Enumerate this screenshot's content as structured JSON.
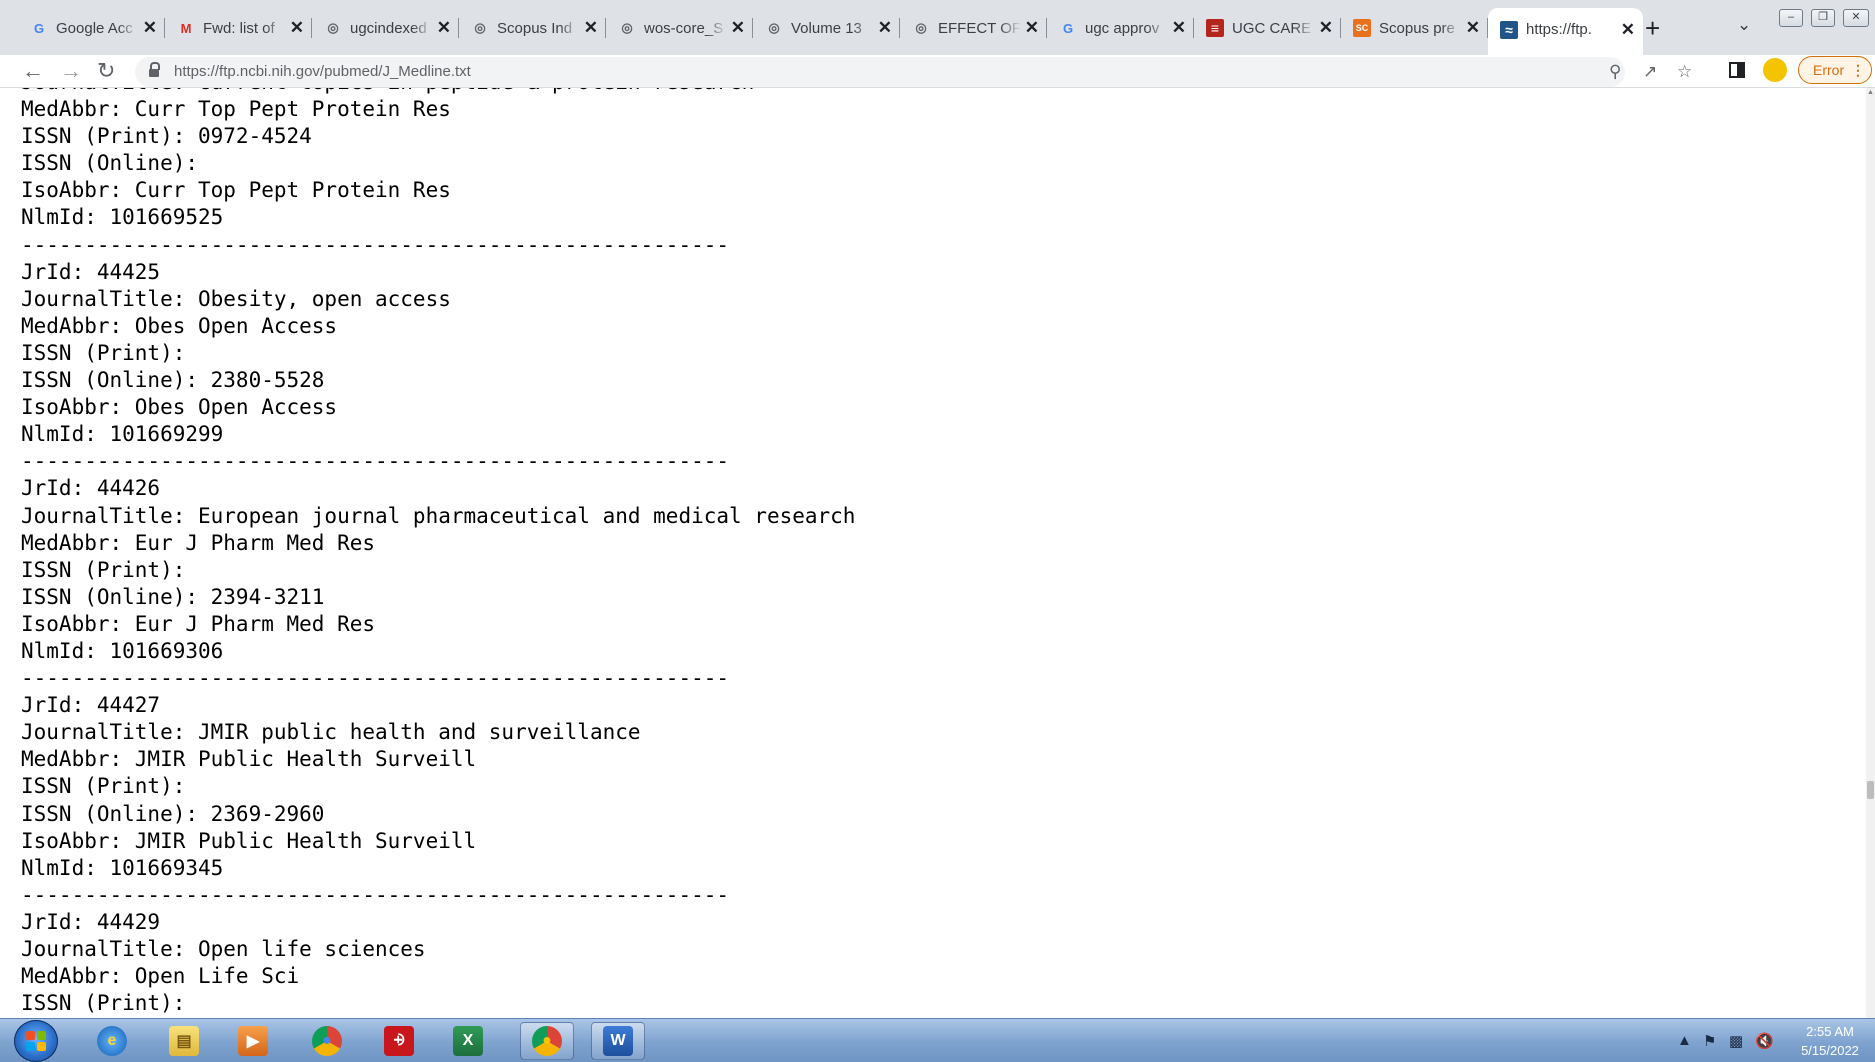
{
  "browser": {
    "tabs": [
      {
        "title": "Google Acc",
        "icon": "google-icon",
        "active": false
      },
      {
        "title": "Fwd: list of",
        "icon": "gmail-icon",
        "active": false
      },
      {
        "title": "ugcindexed",
        "icon": "globe-icon",
        "active": false
      },
      {
        "title": "Scopus Ind",
        "icon": "globe-icon",
        "active": false
      },
      {
        "title": "wos-core_S",
        "icon": "globe-icon",
        "active": false
      },
      {
        "title": "Volume 13",
        "icon": "globe-icon",
        "active": false
      },
      {
        "title": "EFFECT OF",
        "icon": "globe-icon",
        "active": false
      },
      {
        "title": "ugc approv",
        "icon": "google-icon",
        "active": false
      },
      {
        "title": "UGC CARE",
        "icon": "ugc-care-icon",
        "active": false
      },
      {
        "title": "Scopus pre",
        "icon": "scopus-icon",
        "active": false
      },
      {
        "title": "https://ftp.",
        "icon": "ncbi-icon",
        "active": true
      }
    ],
    "url": "https://ftp.ncbi.nih.gov/pubmed/J_Medline.txt",
    "error_label": "Error"
  },
  "document": {
    "lines": [
      "JournalTitle: Current topics in peptide & protein research",
      "MedAbbr: Curr Top Pept Protein Res",
      "ISSN (Print): 0972-4524",
      "ISSN (Online):",
      "IsoAbbr: Curr Top Pept Protein Res",
      "NlmId: 101669525",
      "--------------------------------------------------------",
      "JrId: 44425",
      "JournalTitle: Obesity, open access",
      "MedAbbr: Obes Open Access",
      "ISSN (Print):",
      "ISSN (Online): 2380-5528",
      "IsoAbbr: Obes Open Access",
      "NlmId: 101669299",
      "--------------------------------------------------------",
      "JrId: 44426",
      "JournalTitle: European journal pharmaceutical and medical research",
      "MedAbbr: Eur J Pharm Med Res",
      "ISSN (Print):",
      "ISSN (Online): 2394-3211",
      "IsoAbbr: Eur J Pharm Med Res",
      "NlmId: 101669306",
      "--------------------------------------------------------",
      "JrId: 44427",
      "JournalTitle: JMIR public health and surveillance",
      "MedAbbr: JMIR Public Health Surveill",
      "ISSN (Print):",
      "ISSN (Online): 2369-2960",
      "IsoAbbr: JMIR Public Health Surveill",
      "NlmId: 101669345",
      "--------------------------------------------------------",
      "JrId: 44429",
      "JournalTitle: Open life sciences",
      "MedAbbr: Open Life Sci",
      "ISSN (Print):"
    ],
    "scroll_position": 0.76
  },
  "taskbar": {
    "apps": [
      {
        "name": "internet-explorer",
        "icon": "ie-icon",
        "open": false
      },
      {
        "name": "file-explorer",
        "icon": "folder-icon",
        "open": false
      },
      {
        "name": "media-player",
        "icon": "media-player-icon",
        "open": false
      },
      {
        "name": "chrome",
        "icon": "chrome-icon",
        "open": false
      },
      {
        "name": "acrobat",
        "icon": "acrobat-icon",
        "open": false
      },
      {
        "name": "excel",
        "icon": "excel-icon",
        "open": false
      },
      {
        "name": "chrome-profile",
        "icon": "chrome-profile-icon",
        "open": true
      },
      {
        "name": "word",
        "icon": "word-icon",
        "open": true
      }
    ],
    "clock_time": "2:55 AM",
    "clock_date": "5/15/2022"
  }
}
